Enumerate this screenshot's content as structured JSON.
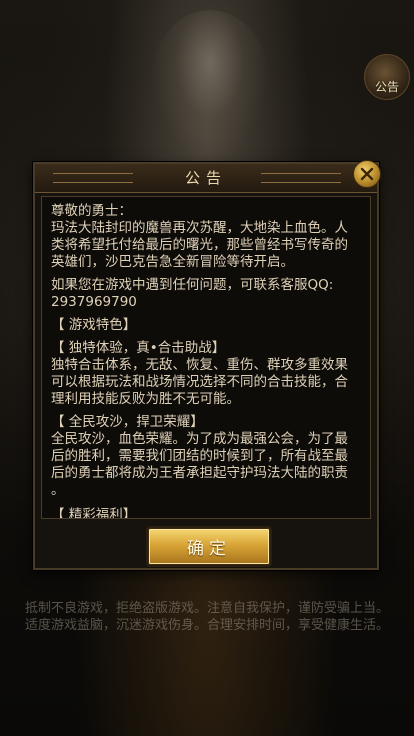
{
  "corner_notice": {
    "label": "公告"
  },
  "dialog": {
    "title": "公告",
    "confirm_label": "确定",
    "content": {
      "greeting": "尊敬的勇士：",
      "intro_lines": [
        "玛法大陆封印的魔兽再次苏醒，大地染上血色。人",
        "类将希望托付给最后的曙光，那些曾经书写传奇的",
        "英雄们，沙巴克告急全新冒险等待开启。"
      ],
      "contact_lines": [
        "如果您在游戏中遇到任何问题，可联系客服QQ:",
        "2937969790"
      ],
      "features_heading": "【 游戏特色】",
      "section1_heading": "【 独特体验，真•合击助战】",
      "section1_lines": [
        "独特合击体系，无敌、恢复、重伤、群攻多重效果",
        "可以根据玩法和战场情况选择不同的合击技能，合",
        "理利用技能反败为胜不无可能。"
      ],
      "section2_heading": "【 全民攻沙，捍卫荣耀】",
      "section2_lines": [
        "全民攻沙，血色荣耀。为了成为最强公会，为了最",
        "后的胜利，需要我们团结的时候到了，所有战至最",
        "后的勇士都将成为王者承担起守护玛法大陆的职责",
        "。"
      ],
      "section3_heading": "【 精彩福利】"
    }
  },
  "bottom_notice": {
    "lines": [
      "抵制不良游戏，拒绝盗版游戏。注意自我保护，谨防受骗上当。",
      "适度游戏益脑，沉迷游戏伤身。合理安排时间，享受健康生活。"
    ]
  },
  "colors": {
    "text": "#dfd1b8",
    "title": "#e9d8ae",
    "button_gold": "#d9a536"
  }
}
